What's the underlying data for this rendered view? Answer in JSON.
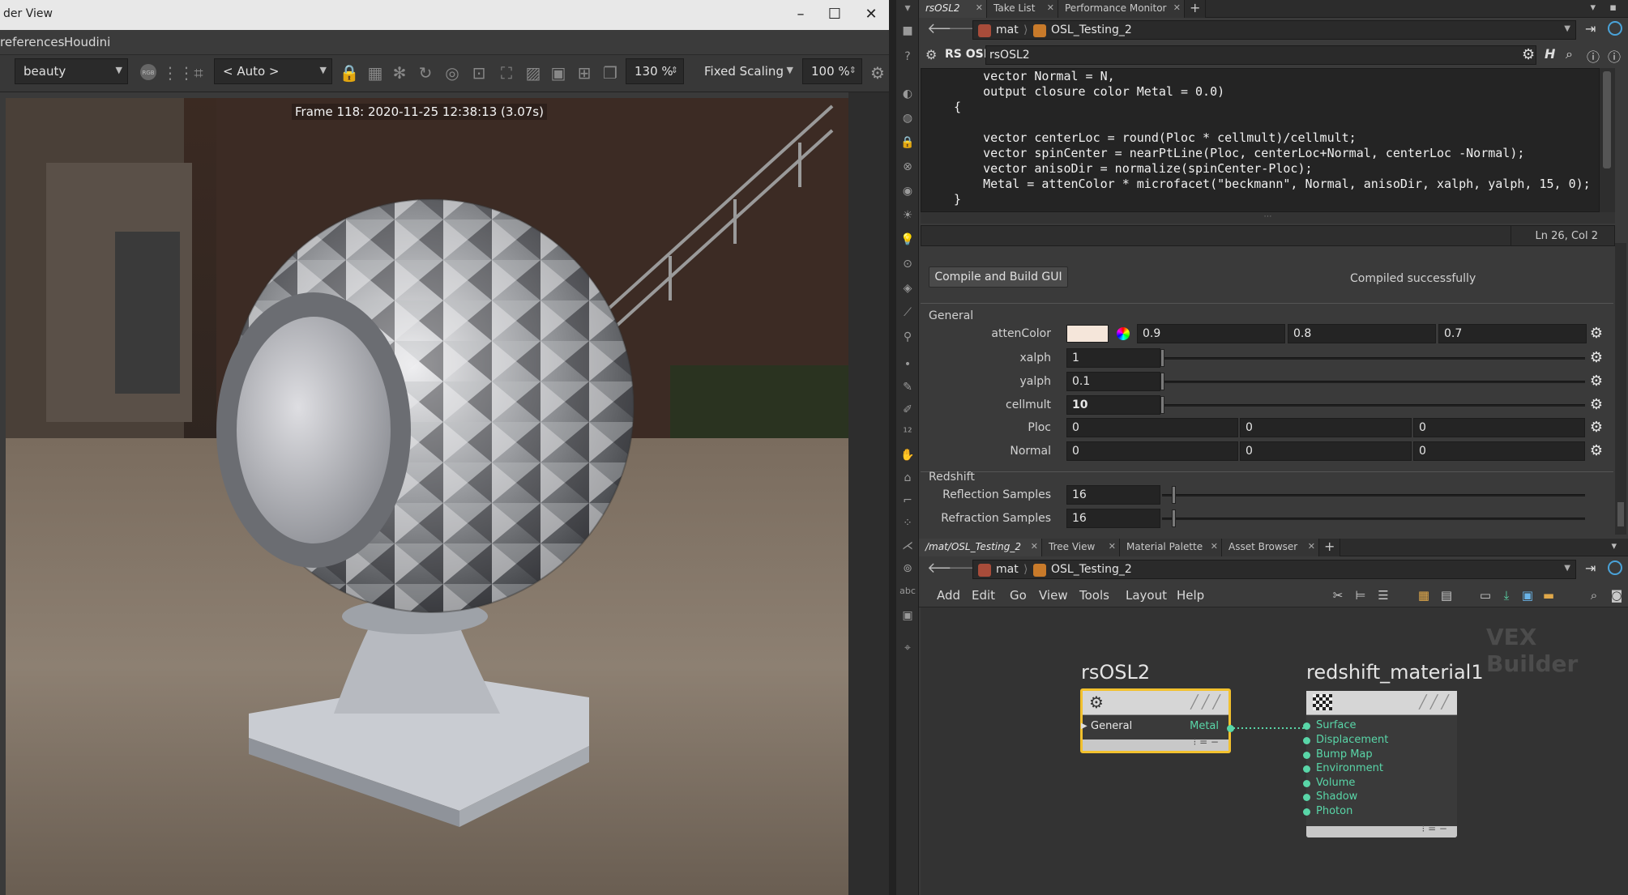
{
  "render_view": {
    "title": "der View",
    "menu": [
      "references",
      "Houdini"
    ],
    "aov_combo": "beauty",
    "camera_combo": "< Auto >",
    "zoom": "130 %",
    "scaling_combo": "Fixed Scaling",
    "scale_pct": "100 %",
    "frame_label": "Frame 118:  2020-11-25  12:38:13  (3.07s)"
  },
  "top_pane": {
    "tabs": [
      "rsOSL2",
      "Take List",
      "Performance Monitor"
    ],
    "path": [
      "mat",
      "OSL_Testing_2"
    ],
    "node_type": "RS OSL",
    "node_name": "rsOSL2"
  },
  "code": {
    "lines": [
      "    vector Normal = N,",
      "    output closure color Metal = 0.0)",
      "{",
      "    vector centerLoc = round(Ploc * cellmult)/cellmult;",
      "    vector spinCenter = nearPtLine(Ploc, centerLoc+Normal, centerLoc -Normal);",
      "    vector anisoDir = normalize(spinCenter-Ploc);",
      "    Metal = attenColor * microfacet(\"beckmann\", Normal, anisoDir, xalph, yalph, 15, 0);",
      "}"
    ],
    "cursor": "Ln 26, Col 2"
  },
  "compile": {
    "button": "Compile and Build GUI",
    "status": "Compiled successfully"
  },
  "params": {
    "general_label": "General",
    "attenColor": {
      "label": "attenColor",
      "r": "0.9",
      "g": "0.8",
      "b": "0.7",
      "swatch": "#f5e6da"
    },
    "xalph": {
      "label": "xalph",
      "value": "1"
    },
    "yalph": {
      "label": "yalph",
      "value": "0.1"
    },
    "cellmult": {
      "label": "cellmult",
      "value": "10"
    },
    "ploc": {
      "label": "Ploc",
      "x": "0",
      "y": "0",
      "z": "0"
    },
    "normal": {
      "label": "Normal",
      "x": "0",
      "y": "0",
      "z": "0"
    },
    "redshift_label": "Redshift",
    "refl": {
      "label": "Reflection Samples",
      "value": "16"
    },
    "refr": {
      "label": "Refraction Samples",
      "value": "16"
    }
  },
  "bottom_pane": {
    "tabs": [
      "/mat/OSL_Testing_2",
      "Tree View",
      "Material Palette",
      "Asset Browser"
    ],
    "path": [
      "mat",
      "OSL_Testing_2"
    ],
    "menu": [
      "Add",
      "Edit",
      "Go",
      "View",
      "Tools",
      "Layout",
      "Help"
    ],
    "context_label": "VEX Builder"
  },
  "network": {
    "node1": {
      "name": "rsOSL2",
      "input": "General",
      "output": "Metal"
    },
    "node2": {
      "name": "redshift_material1",
      "inputs": [
        "Surface",
        "Displacement",
        "Bump Map",
        "Environment",
        "Volume",
        "Shadow",
        "Photon"
      ]
    }
  },
  "colors": {
    "accent_port": "#59d6a8",
    "selected_node": "#f2c12e"
  }
}
